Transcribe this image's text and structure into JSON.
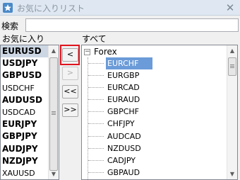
{
  "window": {
    "title": "お気に入りリスト",
    "close_glyph": "✕"
  },
  "search": {
    "label": "検索",
    "value": "",
    "placeholder": ""
  },
  "favorites": {
    "header": "お気に入り",
    "items": [
      {
        "label": "EURUSD",
        "bold": true,
        "selected": true
      },
      {
        "label": "USDJPY",
        "bold": true
      },
      {
        "label": "GBPUSD",
        "bold": true
      },
      {
        "label": "USDCHF",
        "bold": false
      },
      {
        "label": "AUDUSD",
        "bold": true
      },
      {
        "label": "USDCAD",
        "bold": false
      },
      {
        "label": "EURJPY",
        "bold": true
      },
      {
        "label": "GBPJPY",
        "bold": true
      },
      {
        "label": "AUDJPY",
        "bold": true
      },
      {
        "label": "NZDJPY",
        "bold": true
      },
      {
        "label": "XAUUSD",
        "bold": false
      }
    ]
  },
  "transfer_buttons": {
    "add_one": "<",
    "remove_one": ">",
    "add_all": "<<",
    "remove_all": ">>"
  },
  "all_symbols": {
    "header": "すべて",
    "group": {
      "label": "Forex",
      "expander": "−"
    },
    "items": [
      "EURCHF",
      "EURGBP",
      "EURCAD",
      "EURAUD",
      "GBPCHF",
      "CHFJPY",
      "AUDCAD",
      "NZDUSD",
      "CADJPY",
      "GBPAUD"
    ],
    "selected": "EURCHF"
  },
  "icons": {
    "app": "star-list-icon",
    "close": "close-icon",
    "scroll_up": "▲",
    "scroll_down": "▼"
  },
  "colors": {
    "highlight_box": "#e0141e",
    "selection": "#6b9bd8",
    "title_text": "#8a96a3"
  }
}
